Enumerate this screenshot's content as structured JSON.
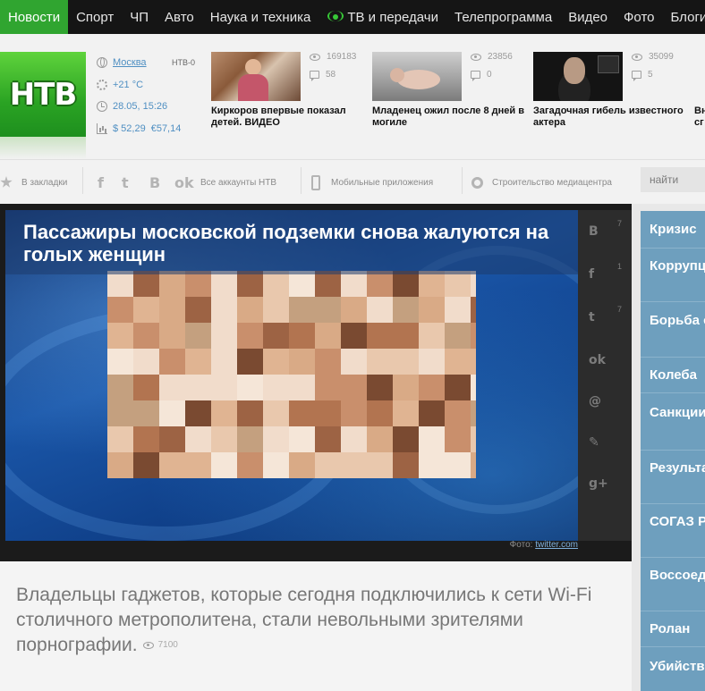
{
  "nav": {
    "items": [
      {
        "label": "Новости",
        "active": true
      },
      {
        "label": "Спорт"
      },
      {
        "label": "ЧП"
      },
      {
        "label": "Авто"
      },
      {
        "label": "Наука и техника"
      },
      {
        "label": "ТВ и передачи",
        "icon": "broadcast-icon"
      },
      {
        "label": "Телепрограмма"
      },
      {
        "label": "Видео"
      },
      {
        "label": "Фото"
      },
      {
        "label": "Блоги"
      }
    ]
  },
  "logo": {
    "text": "НТВ"
  },
  "info": {
    "city": "Москва",
    "channel": "НТВ-0",
    "temperature": "+21 °C",
    "datetime": "28.05, 15:26",
    "usd": "$ 52,29",
    "eur": "€57,14"
  },
  "top_news": [
    {
      "title": "Киркоров впервые показал детей. ВИДЕО",
      "views": "169183",
      "comments": "58"
    },
    {
      "title": "Младенец ожил после 8 дней в могиле",
      "views": "23856",
      "comments": "0"
    },
    {
      "title": "Загадочная гибель известного актера",
      "views": "35099",
      "comments": "5"
    },
    {
      "title": "Вн",
      "title2": "сг"
    }
  ],
  "toolbar": {
    "bookmarks": "В закладки",
    "all_accounts": "Все аккаунты НТВ",
    "mobile": "Мобильные приложения",
    "construction": "Строительство медиацентра",
    "search_placeholder": "найти"
  },
  "article": {
    "headline": "Пассажиры московской подземки снова жалуются на голых женщин",
    "photo_caption": "Фото:",
    "photo_source": "twitter.com",
    "lead": "Владельцы гаджетов, которые сегодня подключились к сети Wi-Fi столичного метрополитена, стали невольными зрителями порнографии.",
    "views": "7100"
  },
  "share": [
    {
      "icon": "vk-icon",
      "glyph": "B",
      "count": "7"
    },
    {
      "icon": "facebook-icon",
      "glyph": "f",
      "count": "1"
    },
    {
      "icon": "twitter-icon",
      "glyph": "t",
      "count": "7"
    },
    {
      "icon": "odnoklassniki-icon",
      "glyph": "ok",
      "count": ""
    },
    {
      "icon": "email-icon",
      "glyph": "@",
      "count": ""
    },
    {
      "icon": "pencil-icon",
      "glyph": "✎",
      "count": ""
    },
    {
      "icon": "googleplus-icon",
      "glyph": "g+",
      "count": ""
    }
  ],
  "rail": {
    "items": [
      "Кризис",
      "Коррупционные скандалы",
      "Борьба с госуда",
      "Колеба",
      "Санкции ответные",
      "Результаты в школах",
      "СОГАЗ России",
      "Воссоединение России",
      "Ролан",
      "Убийство Люберц"
    ]
  },
  "colors": {
    "nav_active": "#30a530",
    "logo_green": "#2aa323",
    "link_blue": "#4f8fc2",
    "rail_blue": "#6e9fbe"
  }
}
